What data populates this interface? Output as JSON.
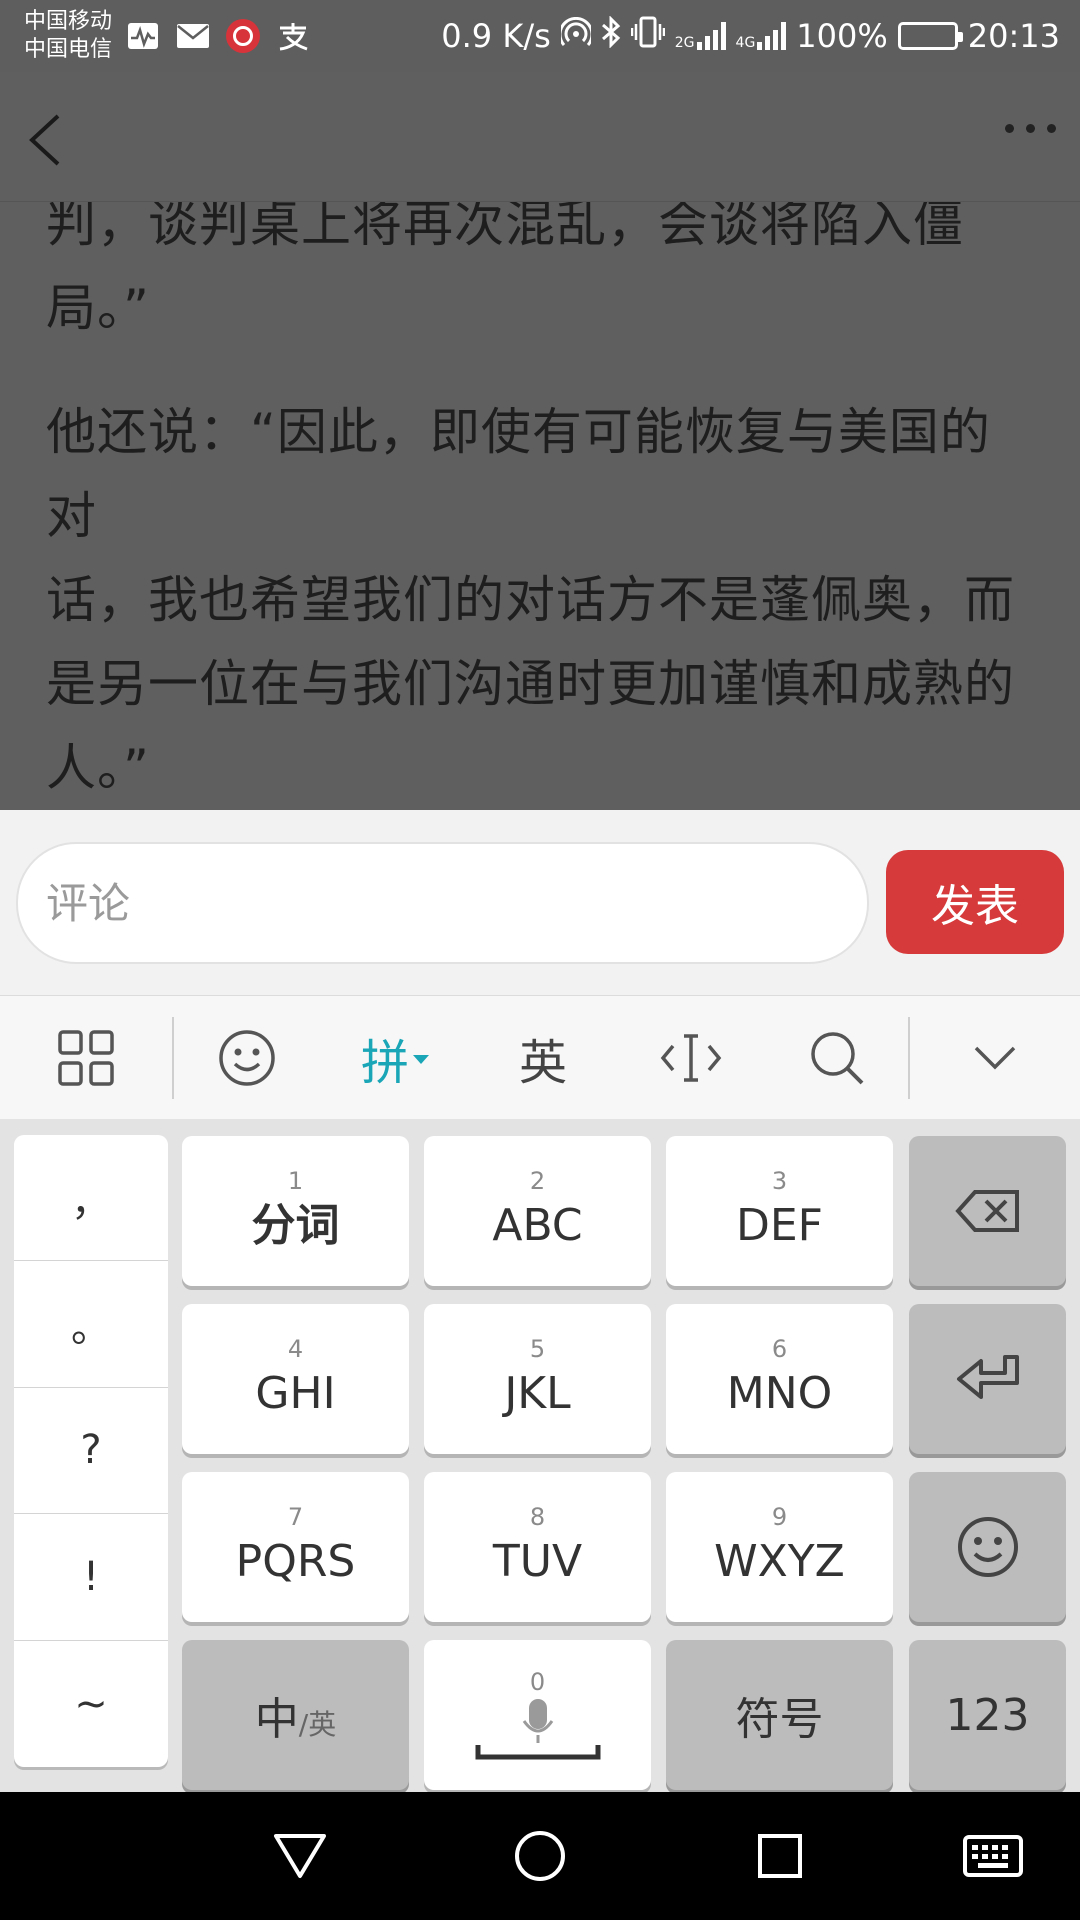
{
  "status_bar": {
    "carrier_1": "中国移动",
    "carrier_2": "中国电信",
    "net_speed": "0.9 K/s",
    "signal_1_tag_top": "2G",
    "signal_2_tag_top": "4G",
    "battery": "100%",
    "time": "20:13"
  },
  "article": {
    "lines_p1": [
      "判，谈判桌上将再次混乱，会谈将陷入僵",
      "局。”"
    ],
    "lines_p2": [
      "他还说：“因此，即使有可能恢复与美国的对",
      "话，我也希望我们的对话方不是蓬佩奥，而",
      "是另一位在与我们沟通时更加谨慎和成熟的",
      "人。”"
    ]
  },
  "comment": {
    "placeholder": "评论",
    "publish_label": "发表",
    "publish_color": "#d63a3a"
  },
  "keyboard_toolbar": {
    "pinyin_label": "拼",
    "english_label": "英",
    "accent_color": "#1aa6b7"
  },
  "keyboard": {
    "punctuation": [
      "，",
      "。",
      "?",
      "!",
      "~"
    ],
    "keys": [
      {
        "num": "1",
        "letters": "分词"
      },
      {
        "num": "2",
        "letters": "ABC"
      },
      {
        "num": "3",
        "letters": "DEF"
      },
      {
        "num": "4",
        "letters": "GHI"
      },
      {
        "num": "5",
        "letters": "JKL"
      },
      {
        "num": "6",
        "letters": "MNO"
      },
      {
        "num": "7",
        "letters": "PQRS"
      },
      {
        "num": "8",
        "letters": "TUV"
      },
      {
        "num": "9",
        "letters": "WXYZ"
      }
    ],
    "space_num": "0",
    "lang_main": "中",
    "lang_sub": "/英",
    "symbols_label": "符号",
    "numeric_label": "123"
  }
}
